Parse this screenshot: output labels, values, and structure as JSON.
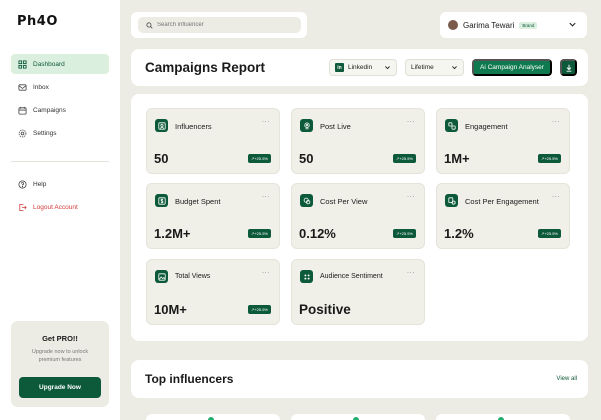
{
  "logo": "Ph4O",
  "colors": {
    "primary": "#0d5a3b",
    "accent": "#0f7a4f",
    "danger": "#d23b3b",
    "background": "#ecece4"
  },
  "sidebar": {
    "items": [
      {
        "label": "Dashboard",
        "icon": "grid-icon",
        "active": true
      },
      {
        "label": "Inbox",
        "icon": "mail-icon"
      },
      {
        "label": "Campaigns",
        "icon": "calendar-icon"
      },
      {
        "label": "Settings",
        "icon": "gear-icon"
      }
    ],
    "bottom_items": [
      {
        "label": "Help",
        "icon": "help-icon"
      },
      {
        "label": "Logout Account",
        "icon": "logout-icon"
      }
    ],
    "pro": {
      "title": "Get PRO!!",
      "subtitle": "Upgrade now to unlock premium features",
      "button": "Upgrade Now"
    }
  },
  "search": {
    "placeholder": "Search influencer"
  },
  "user": {
    "name": "Garima Tewari",
    "badge": "Brand"
  },
  "header": {
    "title": "Campaigns Report",
    "platform": {
      "badge": "in",
      "value": "Linkedin"
    },
    "period": "Lifetime",
    "ai_button": "Ai Campaign Analyser"
  },
  "stats": [
    {
      "label": "Influencers",
      "value": "50",
      "change": "+25.5%",
      "icon": "user-icon"
    },
    {
      "label": "Post Live",
      "value": "50",
      "change": "+25.5%",
      "icon": "location-icon"
    },
    {
      "label": "Engagement",
      "value": "1M+",
      "change": "+25.5%",
      "icon": "engagement-icon"
    },
    {
      "label": "Budget Spent",
      "value": "1.2M+",
      "change": "+25.5%",
      "icon": "dollar-icon"
    },
    {
      "label": "Cost Per View",
      "value": "0.12%",
      "change": "+25.5%",
      "icon": "coins-icon"
    },
    {
      "label": "Cost Per Engagement",
      "value": "1.2%",
      "change": "+25.5%",
      "icon": "cost-engagement-icon"
    },
    {
      "label": "Total Views",
      "value": "10M+",
      "change": "+25.5%",
      "icon": "image-icon"
    },
    {
      "label": "Audience Sentiment",
      "value": "Positive",
      "icon": "sentiment-icon"
    }
  ],
  "more_label": "...",
  "top": {
    "title": "Top influencers",
    "link": "View all"
  }
}
